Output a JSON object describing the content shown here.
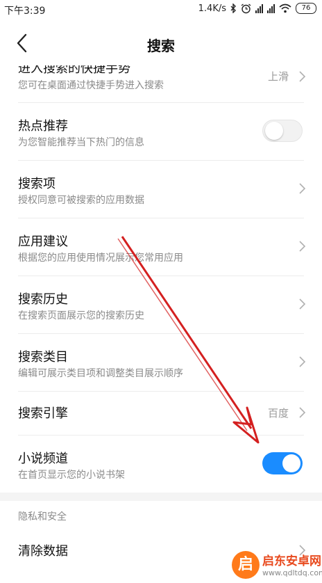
{
  "status_bar": {
    "time": "下午3:39",
    "network_speed": "1.4K/s",
    "battery": "76",
    "icons": [
      "bluetooth-icon",
      "alarm-icon",
      "signal-icon",
      "signal-icon",
      "wifi-icon",
      "battery-icon"
    ]
  },
  "header": {
    "title": "搜索",
    "back_icon": "back-chevron-icon"
  },
  "settings": {
    "gesture": {
      "title": "进入搜索的快捷手势",
      "subtitle": "您可在桌面通过快捷手势进入搜索",
      "value": "上滑"
    },
    "hot_recommend": {
      "title": "热点推荐",
      "subtitle": "为您智能推荐当下热门的信息",
      "toggle": "off"
    },
    "search_items": {
      "title": "搜索项",
      "subtitle": "授权同意可被搜索的应用数据"
    },
    "app_suggest": {
      "title": "应用建议",
      "subtitle": "根据您的应用使用情况展示您常用应用"
    },
    "history": {
      "title": "搜索历史",
      "subtitle": "在搜索页面展示您的搜索历史"
    },
    "categories": {
      "title": "搜索类目",
      "subtitle": "编辑可展示类目项和调整类目展示顺序"
    },
    "engine": {
      "title": "搜索引擎",
      "value": "百度"
    },
    "novel": {
      "title": "小说频道",
      "subtitle": "在首页显示您的小说书架",
      "toggle": "on"
    }
  },
  "privacy_section": {
    "header": "隐私和安全",
    "clear_data": {
      "title": "清除数据"
    }
  },
  "watermark": {
    "title": "启东安卓网",
    "url": "www.qdltdq.com",
    "badge": "启"
  },
  "colors": {
    "toggle_on": "#1a8cff",
    "annotation_arrow": "#d42020"
  }
}
